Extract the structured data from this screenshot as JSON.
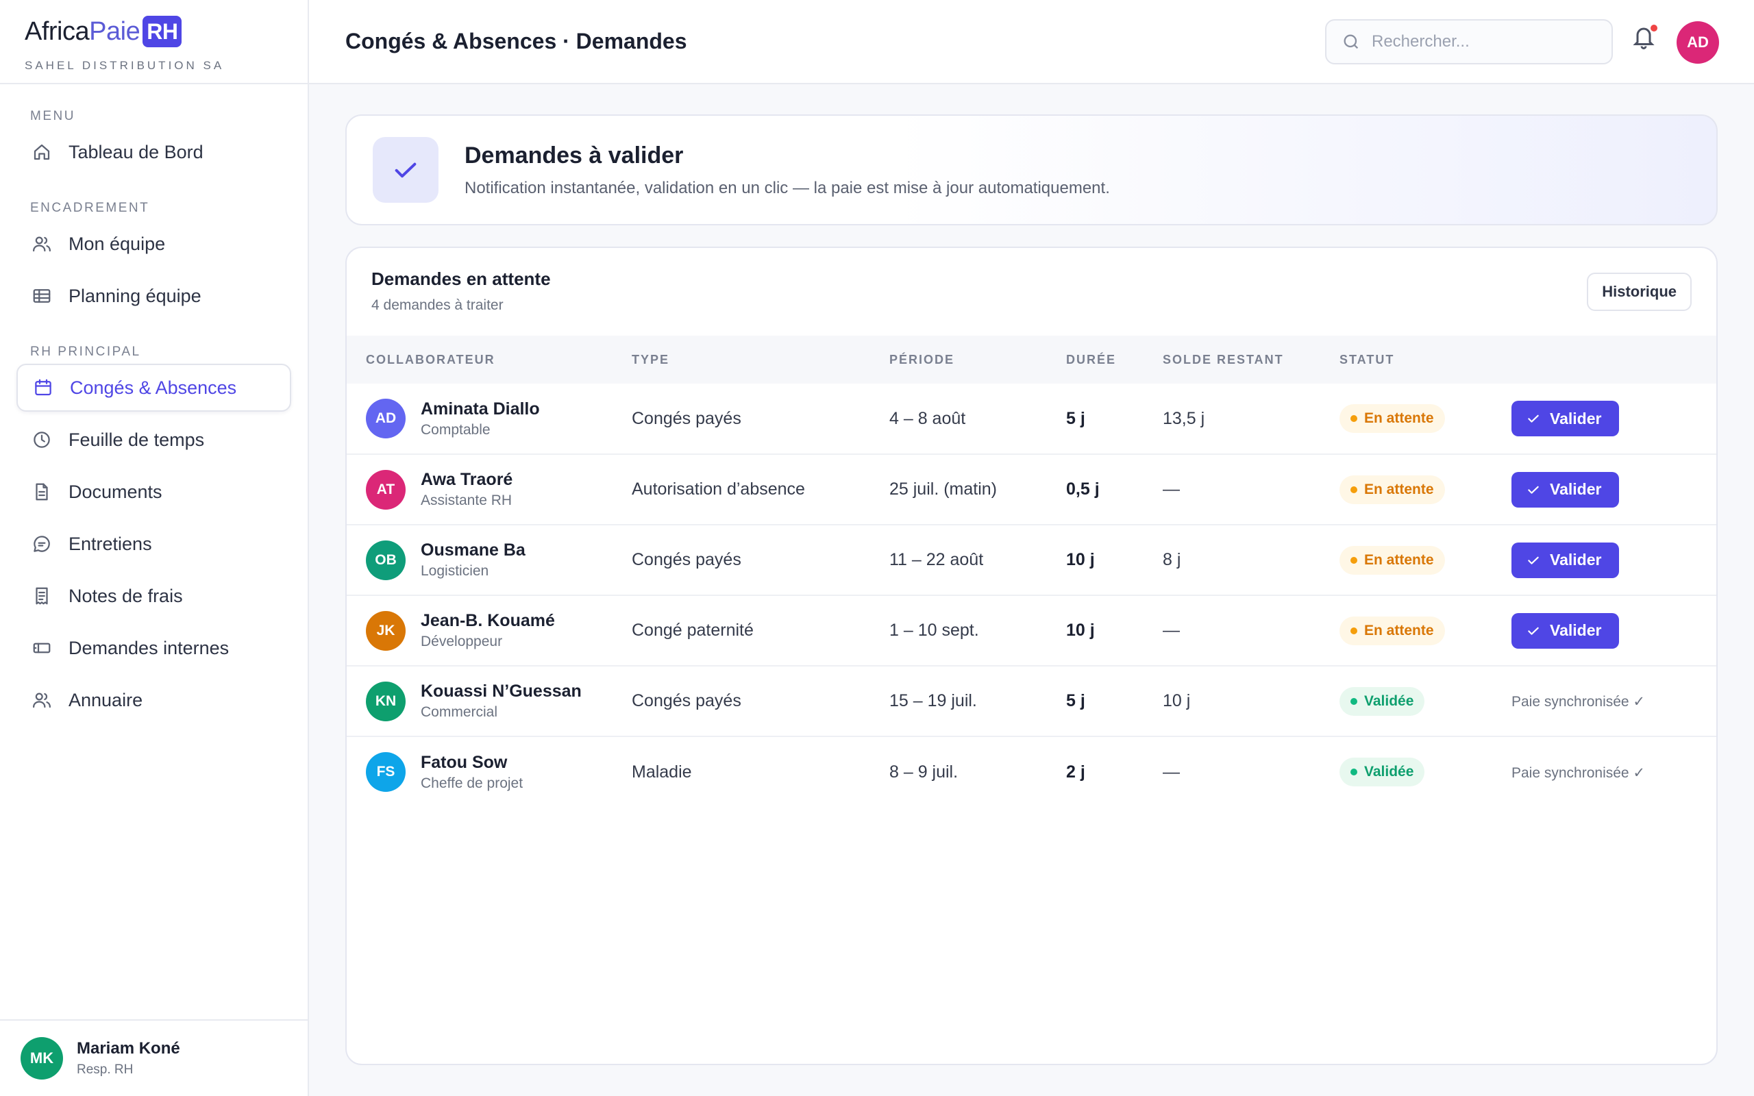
{
  "brand": {
    "name_part1": "Africa",
    "name_part2": "Paie",
    "name_badge": "RH",
    "company": "SAHEL DISTRIBUTION SA"
  },
  "sidebar": {
    "sections": [
      {
        "label": "MENU",
        "items": [
          {
            "label": "Tableau de Bord",
            "icon": "home-icon"
          }
        ]
      },
      {
        "label": "ENCADREMENT",
        "items": [
          {
            "label": "Mon équipe",
            "icon": "users-icon"
          },
          {
            "label": "Planning équipe",
            "icon": "table-icon"
          }
        ]
      },
      {
        "label": "RH PRINCIPAL",
        "items": [
          {
            "label": "Congés & Absences",
            "icon": "calendar-icon",
            "active": true
          },
          {
            "label": "Feuille de temps",
            "icon": "clock-icon"
          },
          {
            "label": "Documents",
            "icon": "document-icon"
          },
          {
            "label": "Entretiens",
            "icon": "chat-icon"
          },
          {
            "label": "Notes de frais",
            "icon": "receipt-icon"
          },
          {
            "label": "Demandes internes",
            "icon": "ticket-icon"
          },
          {
            "label": "Annuaire",
            "icon": "users-icon"
          }
        ]
      }
    ],
    "user": {
      "initials": "MK",
      "name": "Mariam Koné",
      "role": "Resp. RH"
    }
  },
  "header": {
    "title": "Congés & Absences · Demandes",
    "search_placeholder": "Rechercher...",
    "avatar_initials": "AD"
  },
  "banner": {
    "title": "Demandes à valider",
    "subtitle": "Notification instantanée, validation en un clic — la paie est mise à jour automatiquement."
  },
  "requests": {
    "title": "Demandes en attente",
    "subtitle": "4 demandes à traiter",
    "history_label": "Historique",
    "columns": [
      "COLLABORATEUR",
      "TYPE",
      "PÉRIODE",
      "DURÉE",
      "SOLDE RESTANT",
      "STATUT"
    ],
    "validate_label": "Valider",
    "rows": [
      {
        "initials": "AD",
        "color": "#6366f1",
        "name": "Aminata Diallo",
        "role": "Comptable",
        "type": "Congés payés",
        "period": "4 – 8 août",
        "duration": "5 j",
        "balance": "13,5 j",
        "status": "En attente",
        "state": "pending"
      },
      {
        "initials": "AT",
        "color": "#db2777",
        "name": "Awa Traoré",
        "role": "Assistante RH",
        "type": "Autorisation d’absence",
        "period": "25 juil. (matin)",
        "duration": "0,5 j",
        "balance": "—",
        "status": "En attente",
        "state": "pending"
      },
      {
        "initials": "OB",
        "color": "#0f9d7a",
        "name": "Ousmane Ba",
        "role": "Logisticien",
        "type": "Congés payés",
        "period": "11 – 22 août",
        "duration": "10 j",
        "balance": "8 j",
        "status": "En attente",
        "state": "pending"
      },
      {
        "initials": "JK",
        "color": "#d97706",
        "name": "Jean-B. Kouamé",
        "role": "Développeur",
        "type": "Congé paternité",
        "period": "1 – 10 sept.",
        "duration": "10 j",
        "balance": "—",
        "status": "En attente",
        "state": "pending"
      },
      {
        "initials": "KN",
        "color": "#0e9f6e",
        "name": "Kouassi N’Guessan",
        "role": "Commercial",
        "type": "Congés payés",
        "period": "15 – 19 juil.",
        "duration": "5 j",
        "balance": "10 j",
        "status": "Validée",
        "state": "done",
        "note": "Paie synchronisée ✓"
      },
      {
        "initials": "FS",
        "color": "#0ea5e9",
        "name": "Fatou Sow",
        "role": "Cheffe de projet",
        "type": "Maladie",
        "period": "8 – 9 juil.",
        "duration": "2 j",
        "balance": "—",
        "status": "Validée",
        "state": "done",
        "note": "Paie synchronisée ✓"
      }
    ]
  }
}
